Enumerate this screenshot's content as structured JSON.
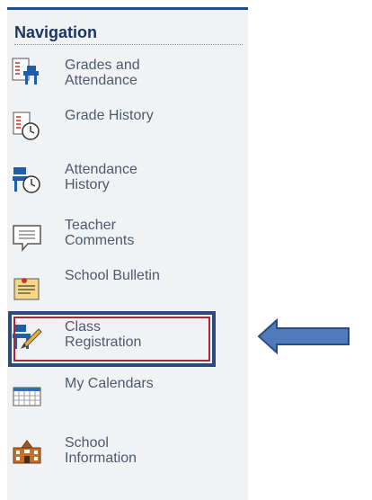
{
  "navigation": {
    "title": "Navigation",
    "items": [
      {
        "id": "grades-attendance",
        "lines": [
          "Grades and",
          "Attendance"
        ],
        "icon": "grades-attendance-icon"
      },
      {
        "id": "grade-history",
        "lines": [
          "Grade History",
          ""
        ],
        "icon": "grade-history-icon"
      },
      {
        "id": "attendance-history",
        "lines": [
          "Attendance",
          "History"
        ],
        "icon": "attendance-history-icon"
      },
      {
        "id": "teacher-comments",
        "lines": [
          "Teacher",
          "Comments"
        ],
        "icon": "speech-bubble-icon"
      },
      {
        "id": "school-bulletin",
        "lines": [
          "School Bulletin",
          ""
        ],
        "icon": "bulletin-icon"
      },
      {
        "id": "class-registration",
        "lines": [
          "Class",
          "Registration"
        ],
        "icon": "class-registration-icon"
      },
      {
        "id": "my-calendars",
        "lines": [
          "My Calendars",
          ""
        ],
        "icon": "calendar-icon"
      },
      {
        "id": "school-information",
        "lines": [
          "School",
          "Information"
        ],
        "icon": "school-building-icon"
      }
    ]
  },
  "annotation": {
    "highlighted_item": "class-registration",
    "arrow_color": "#4f7bbd",
    "highlight_color": "#2c4a7c",
    "highlight_inner_color": "#a52a3a"
  },
  "colors": {
    "panel_bg": "#f1f2f4",
    "title": "#1e3560",
    "label": "#4e5a6e",
    "topbar": "#1f4e8c"
  }
}
